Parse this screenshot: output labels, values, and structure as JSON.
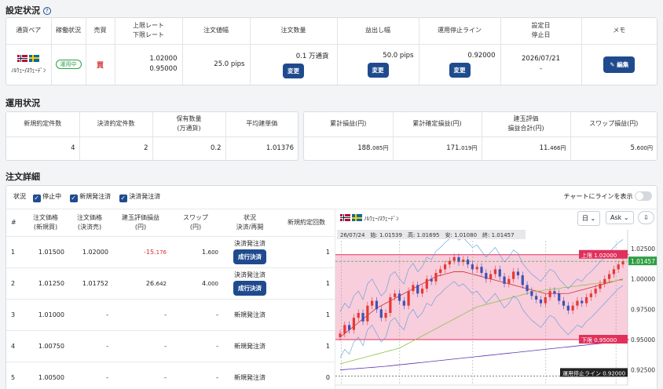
{
  "settings": {
    "title": "設定状況",
    "headers": [
      "通貨ペア",
      "稼働状況",
      "売買",
      "上限レート",
      "下限レート",
      "注文値幅",
      "注文数量",
      "益出し幅",
      "運用停止ライン",
      "設定日",
      "停止日",
      "メモ"
    ],
    "row": {
      "pair": "ﾉﾙｳｪｰ/ｽｳｪｰﾃﾞﾝ",
      "status": "運用中",
      "side": "買",
      "upper": "1.02000",
      "lower": "0.95000",
      "order_width": "25.0 pips",
      "order_qty": "0.1 万通貨",
      "take_profit": "50.0 pips",
      "stop_line": "0.92000",
      "set_date": "2026/07/21",
      "stop_date": "-",
      "change_label": "変更",
      "edit_label": "編集"
    }
  },
  "operation": {
    "title": "運用状況",
    "left_headers": [
      "新規約定件数",
      "決済約定件数",
      "保有数量",
      "(万通貨)",
      "平均建単価"
    ],
    "left_values": [
      "4",
      "2",
      "0.2",
      "1.01376"
    ],
    "right_headers": [
      "累計損益(円)",
      "累計確定損益(円)",
      "建玉評価",
      "損益合計(円)",
      "スワップ損益(円)"
    ],
    "right_values": [
      {
        "main": "188.",
        "dec": "085円"
      },
      {
        "main": "171.",
        "dec": "019円"
      },
      {
        "main": "11.",
        "dec": "466円"
      },
      {
        "main": "5.",
        "dec": "600円"
      }
    ]
  },
  "detail": {
    "title": "注文詳細",
    "filter_label": "状況",
    "filters": [
      "停止中",
      "新規発注済",
      "決済発注済"
    ],
    "toggle_label": "チャートにラインを表示",
    "headers": {
      "no": "#",
      "open_price": "注文価格",
      "open_price2": "(新規買)",
      "close_price": "注文価格",
      "close_price2": "(決済売)",
      "pnl": "建玉評価損益",
      "pnl2": "(円)",
      "swap": "スワップ",
      "swap2": "(円)",
      "state": "状況",
      "state2": "決済/再開",
      "count": "新規約定回数"
    },
    "rows": [
      {
        "no": "1",
        "open": "1.01500",
        "close": "1.02000",
        "pnl": "-15.",
        "pnl_dec": "176",
        "swap": "1.",
        "swap_dec": "600",
        "state": "決済発注済",
        "btn": "成行決済",
        "count": "1"
      },
      {
        "no": "2",
        "open": "1.01250",
        "close": "1.01752",
        "pnl": "26.",
        "pnl_dec": "642",
        "swap": "4.",
        "swap_dec": "000",
        "state": "決済発注済",
        "btn": "成行決済",
        "count": "1"
      },
      {
        "no": "3",
        "open": "1.01000",
        "close": "-",
        "pnl": "-",
        "pnl_dec": "",
        "swap": "-",
        "swap_dec": "",
        "state": "新規発注済",
        "btn": "",
        "count": "1"
      },
      {
        "no": "4",
        "open": "1.00750",
        "close": "-",
        "pnl": "-",
        "pnl_dec": "",
        "swap": "-",
        "swap_dec": "",
        "state": "新規発注済",
        "btn": "",
        "count": "1"
      },
      {
        "no": "5",
        "open": "1.00500",
        "close": "-",
        "pnl": "-",
        "pnl_dec": "",
        "swap": "-",
        "swap_dec": "",
        "state": "新規発注済",
        "btn": "",
        "count": "0"
      }
    ]
  },
  "chart": {
    "pair": "ﾉﾙｳｪｰ/ｽｳｪｰﾃﾞﾝ",
    "timeframe": "日",
    "price_type": "Ask",
    "ohlc_text": "26/07/24　始: 1.01539　高: 1.01695　安: 1.01080　終: 1.01457",
    "upper_label": "上限  1.02000",
    "lower_label": "下限  0.95000",
    "current_label": "1.01457",
    "stop_label": "運用停止ライン  0.92000",
    "colors": {
      "band": "#f7c4d6",
      "band_line": "#e0305b",
      "up": "#e53935",
      "down": "#3f51b5",
      "current": "#2e9e44"
    },
    "y_ticks": [
      "1.02500",
      "1.00000",
      "0.97500",
      "0.95000",
      "0.92500"
    ],
    "x_ticks": [
      "9",
      "04/13",
      "05/18",
      "06/22",
      "07/2"
    ]
  },
  "chart_data": {
    "type": "line",
    "title": "",
    "xlabel": "",
    "ylabel": "",
    "ylim": [
      0.9125,
      1.0315
    ],
    "upper": 1.02,
    "lower": 0.95,
    "current": 1.01457,
    "stop": 0.92,
    "x_ticks": [
      "9",
      "04/13",
      "05/18",
      "06/22",
      "07/2"
    ],
    "y_ticks": [
      1.025,
      1.0,
      0.975,
      0.95,
      0.925
    ],
    "close": [
      0.955,
      0.962,
      0.958,
      0.968,
      0.972,
      0.965,
      0.978,
      0.982,
      0.975,
      0.968,
      0.972,
      0.985,
      0.988,
      0.982,
      0.978,
      0.99,
      0.995,
      0.988,
      0.992,
      1.0,
      0.998,
      1.005,
      1.008,
      1.012,
      1.015,
      1.018,
      1.014,
      1.016,
      1.012,
      1.008,
      1.01,
      1.005,
      1.0,
      1.004,
      1.008,
      1.002,
      0.996,
      1.0,
      1.006,
      1.003,
      0.995,
      0.99,
      0.986,
      0.983,
      0.98,
      0.985,
      0.99,
      0.988,
      0.982,
      0.978,
      0.974,
      0.978,
      0.982,
      0.98,
      0.985,
      0.988,
      0.992,
      0.996,
      1.0,
      1.004,
      1.008,
      1.012,
      1.01457
    ],
    "series": [
      {
        "name": "",
        "values": [
          0.952,
          0.955,
          0.958,
          0.961,
          0.964,
          0.967,
          0.97,
          0.973,
          0.976,
          0.978,
          0.98,
          0.982,
          0.984,
          0.986,
          0.988,
          0.99,
          0.992,
          0.994,
          0.996,
          0.998,
          1.0,
          1.002,
          1.003,
          1.004,
          1.005,
          1.006,
          1.006,
          1.006,
          1.005,
          1.004,
          1.003,
          1.002,
          1.001,
          1.0,
          0.999,
          0.998,
          0.997,
          0.996,
          0.995,
          0.994,
          0.993,
          0.992,
          0.991,
          0.99,
          0.989,
          0.988,
          0.988,
          0.988,
          0.988,
          0.988,
          0.988,
          0.989,
          0.99,
          0.991,
          0.992,
          0.993,
          0.994,
          0.995,
          0.996,
          0.997,
          0.998,
          0.999,
          1.0
        ]
      },
      {
        "name": "",
        "values": [
          0.93,
          0.931,
          0.932,
          0.933,
          0.934,
          0.935,
          0.936,
          0.937,
          0.938,
          0.939,
          0.94,
          0.941,
          0.942,
          0.943,
          0.945,
          0.947,
          0.949,
          0.951,
          0.953,
          0.955,
          0.957,
          0.959,
          0.961,
          0.963,
          0.965,
          0.967,
          0.969,
          0.971,
          0.973,
          0.975,
          0.977,
          0.978,
          0.979,
          0.98,
          0.981,
          0.982,
          0.983,
          0.984,
          0.985,
          0.986,
          0.987,
          0.988,
          0.989,
          0.99,
          0.99,
          0.991,
          0.991,
          0.992,
          0.992,
          0.993,
          0.993,
          0.994,
          0.994,
          0.995,
          0.995,
          0.996,
          0.996,
          0.997,
          0.997,
          0.998,
          0.998,
          0.999,
          0.999
        ]
      },
      {
        "name": "",
        "values": [
          0.925,
          0.9253,
          0.9256,
          0.9259,
          0.9262,
          0.9265,
          0.9268,
          0.9271,
          0.9274,
          0.9277,
          0.928,
          0.9284,
          0.9288,
          0.9292,
          0.9296,
          0.93,
          0.9304,
          0.9308,
          0.9312,
          0.9316,
          0.932,
          0.9324,
          0.9328,
          0.9332,
          0.9336,
          0.934,
          0.9344,
          0.9348,
          0.9352,
          0.9356,
          0.936,
          0.9364,
          0.9368,
          0.9372,
          0.9376,
          0.938,
          0.9384,
          0.9388,
          0.9392,
          0.9396,
          0.94,
          0.9404,
          0.9408,
          0.9412,
          0.9416,
          0.942,
          0.9424,
          0.9428,
          0.9432,
          0.9436,
          0.944,
          0.9444,
          0.9448,
          0.9452,
          0.9456,
          0.946,
          0.9464,
          0.9468,
          0.9472,
          0.9476,
          0.948,
          0.9484,
          0.9488
        ]
      }
    ]
  }
}
